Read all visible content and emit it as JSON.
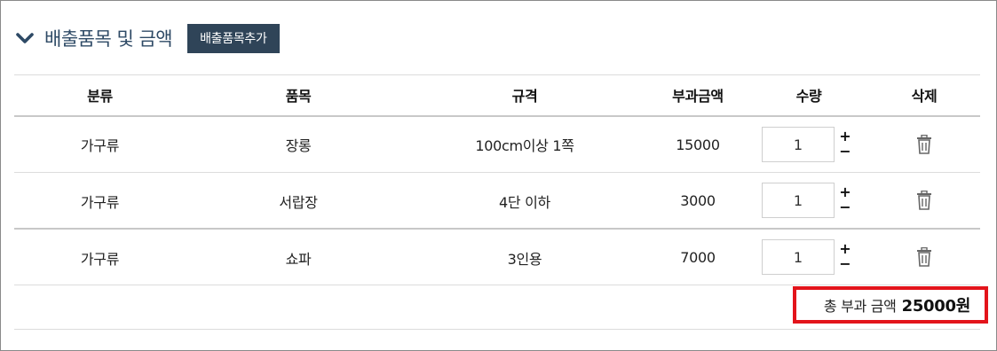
{
  "section": {
    "title": "배출품목 및 금액",
    "add_button_label": "배출품목추가"
  },
  "table": {
    "headers": [
      "분류",
      "품목",
      "규격",
      "부과금액",
      "수량",
      "삭제"
    ],
    "rows": [
      {
        "category": "가구류",
        "item": "장롱",
        "spec": "100cm이상 1쪽",
        "fee": "15000",
        "qty": "1"
      },
      {
        "category": "가구류",
        "item": "서랍장",
        "spec": "4단 이하",
        "fee": "3000",
        "qty": "1"
      },
      {
        "category": "가구류",
        "item": "쇼파",
        "spec": "3인용",
        "fee": "7000",
        "qty": "1"
      }
    ],
    "plus_glyph": "+",
    "minus_glyph": "−"
  },
  "total": {
    "label": "총 부과 금액",
    "amount": "25000원"
  },
  "icons": {
    "section_toggle": "chevron-down-icon",
    "delete": "trash-icon"
  },
  "colors": {
    "title": "#2e4a66",
    "button_bg": "#2f4458",
    "highlight": "#e3141b"
  }
}
